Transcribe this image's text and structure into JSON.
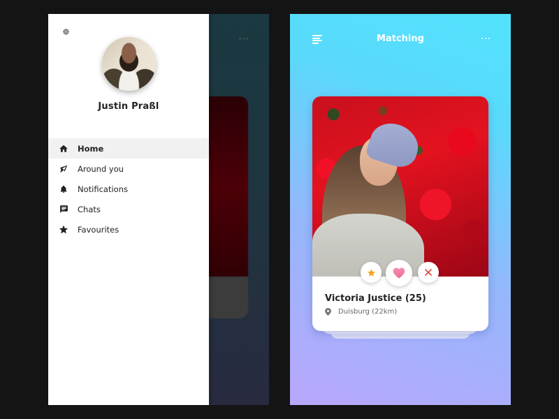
{
  "left_screen": {
    "background_title_hint": "...",
    "drawer": {
      "settings_icon": "gear-icon",
      "user_name": "Justin Praßl",
      "menu": [
        {
          "label": "Home",
          "icon": "home-icon",
          "active": true
        },
        {
          "label": "Around you",
          "icon": "compass-icon",
          "active": false
        },
        {
          "label": "Notifications",
          "icon": "bell-icon",
          "active": false
        },
        {
          "label": "Chats",
          "icon": "chat-icon",
          "active": false
        },
        {
          "label": "Favourites",
          "icon": "star-icon",
          "active": false
        }
      ]
    }
  },
  "right_screen": {
    "header": {
      "title": "Matching",
      "menu_icon": "hamburger-icon",
      "more_icon": "more-icon"
    },
    "card": {
      "name": "Victoria Justice (25)",
      "location": "Duisburg (22km)",
      "actions": [
        {
          "name": "favourite",
          "icon": "star-icon",
          "color": "#f5a623"
        },
        {
          "name": "like",
          "icon": "heart-icon",
          "color": "#f06292"
        },
        {
          "name": "dismiss",
          "icon": "close-icon",
          "color": "#e53935"
        }
      ]
    }
  },
  "colors": {
    "page_bg": "#141414",
    "gradient_top": "#52e3fc",
    "gradient_bottom": "#b9a7fc",
    "active_item_bg": "#f1f1f1"
  }
}
